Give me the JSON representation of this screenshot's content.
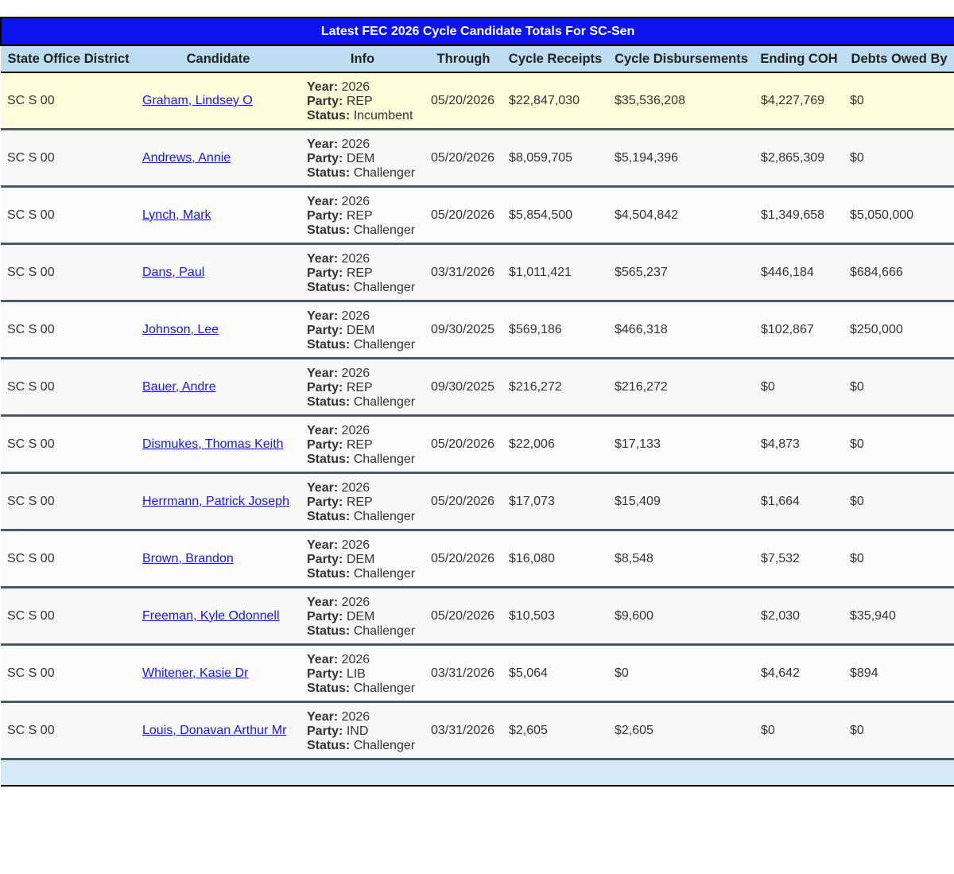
{
  "title": "Latest FEC 2026 Cycle Candidate Totals For SC-Sen",
  "columns": [
    "State Office District",
    "Candidate",
    "Info",
    "Through",
    "Cycle Receipts",
    "Cycle Disbursements",
    "Ending COH",
    "Debts Owed By"
  ],
  "info_labels": {
    "year": "Year:",
    "party": "Party:",
    "status": "Status:"
  },
  "rows": [
    {
      "district": "SC S 00",
      "candidate": "Graham, Lindsey O",
      "year": "2026",
      "party": "REP",
      "status": "Incumbent",
      "through": "05/20/2026",
      "receipts": "$22,847,030",
      "disbursements": "$35,536,208",
      "coh": "$4,227,769",
      "debts": "$0"
    },
    {
      "district": "SC S 00",
      "candidate": "Andrews, Annie",
      "year": "2026",
      "party": "DEM",
      "status": "Challenger",
      "through": "05/20/2026",
      "receipts": "$8,059,705",
      "disbursements": "$5,194,396",
      "coh": "$2,865,309",
      "debts": "$0"
    },
    {
      "district": "SC S 00",
      "candidate": "Lynch, Mark",
      "year": "2026",
      "party": "REP",
      "status": "Challenger",
      "through": "05/20/2026",
      "receipts": "$5,854,500",
      "disbursements": "$4,504,842",
      "coh": "$1,349,658",
      "debts": "$5,050,000"
    },
    {
      "district": "SC S 00",
      "candidate": "Dans, Paul",
      "year": "2026",
      "party": "REP",
      "status": "Challenger",
      "through": "03/31/2026",
      "receipts": "$1,011,421",
      "disbursements": "$565,237",
      "coh": "$446,184",
      "debts": "$684,666"
    },
    {
      "district": "SC S 00",
      "candidate": "Johnson, Lee",
      "year": "2026",
      "party": "DEM",
      "status": "Challenger",
      "through": "09/30/2025",
      "receipts": "$569,186",
      "disbursements": "$466,318",
      "coh": "$102,867",
      "debts": "$250,000"
    },
    {
      "district": "SC S 00",
      "candidate": "Bauer, Andre",
      "year": "2026",
      "party": "REP",
      "status": "Challenger",
      "through": "09/30/2025",
      "receipts": "$216,272",
      "disbursements": "$216,272",
      "coh": "$0",
      "debts": "$0"
    },
    {
      "district": "SC S 00",
      "candidate": "Dismukes, Thomas Keith",
      "year": "2026",
      "party": "REP",
      "status": "Challenger",
      "through": "05/20/2026",
      "receipts": "$22,006",
      "disbursements": "$17,133",
      "coh": "$4,873",
      "debts": "$0"
    },
    {
      "district": "SC S 00",
      "candidate": "Herrmann, Patrick Joseph",
      "year": "2026",
      "party": "REP",
      "status": "Challenger",
      "through": "05/20/2026",
      "receipts": "$17,073",
      "disbursements": "$15,409",
      "coh": "$1,664",
      "debts": "$0"
    },
    {
      "district": "SC S 00",
      "candidate": "Brown, Brandon",
      "year": "2026",
      "party": "DEM",
      "status": "Challenger",
      "through": "05/20/2026",
      "receipts": "$16,080",
      "disbursements": "$8,548",
      "coh": "$7,532",
      "debts": "$0"
    },
    {
      "district": "SC S 00",
      "candidate": "Freeman, Kyle Odonnell",
      "year": "2026",
      "party": "DEM",
      "status": "Challenger",
      "through": "05/20/2026",
      "receipts": "$10,503",
      "disbursements": "$9,600",
      "coh": "$2,030",
      "debts": "$35,940"
    },
    {
      "district": "SC S 00",
      "candidate": "Whitener, Kasie Dr",
      "year": "2026",
      "party": "LIB",
      "status": "Challenger",
      "through": "03/31/2026",
      "receipts": "$5,064",
      "disbursements": "$0",
      "coh": "$4,642",
      "debts": "$894"
    },
    {
      "district": "SC S 00",
      "candidate": "Louis, Donavan Arthur Mr",
      "year": "2026",
      "party": "IND",
      "status": "Challenger",
      "through": "03/31/2026",
      "receipts": "$2,605",
      "disbursements": "$2,605",
      "coh": "$0",
      "debts": "$0"
    }
  ],
  "colors": {
    "title_bg": "#0a14ef",
    "header_bg": "#bdddf3",
    "highlight_bg": "#fffcd9",
    "link": "#1a1ad6",
    "footer_bg": "#d6e9f7"
  }
}
